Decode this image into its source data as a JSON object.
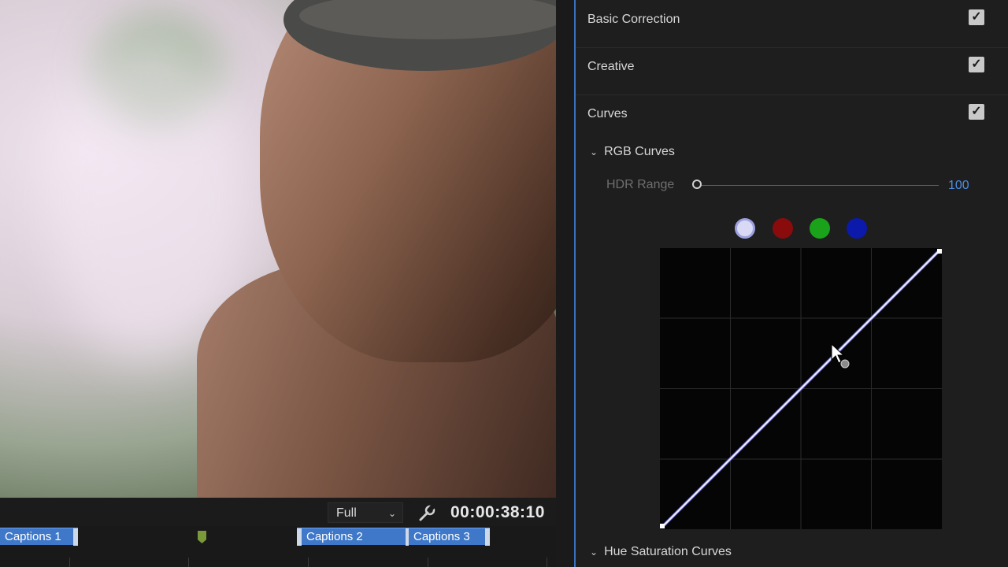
{
  "preview": {
    "resolution": "Full",
    "timecode": "00:00:38:10"
  },
  "timeline": {
    "clips": [
      {
        "label": "Captions 1"
      },
      {
        "label": "Captions 2"
      },
      {
        "label": "Captions 3"
      }
    ]
  },
  "panel": {
    "sections": [
      {
        "label": "Basic Correction",
        "checked": true
      },
      {
        "label": "Creative",
        "checked": true
      },
      {
        "label": "Curves",
        "checked": true
      }
    ],
    "rgb_curves": {
      "label": "RGB Curves",
      "hdr_label": "HDR Range",
      "hdr_value": "100",
      "channels": [
        {
          "name": "white",
          "color": "#d9d9f6",
          "active": true
        },
        {
          "name": "red",
          "color": "#8a0b0b"
        },
        {
          "name": "green",
          "color": "#1aa31a"
        },
        {
          "name": "blue",
          "color": "#0b1aaa"
        }
      ]
    },
    "hue_label": "Hue Saturation Curves"
  },
  "colors": {
    "accent": "#3a72c0",
    "value_blue": "#4b8ee6",
    "caption_clip": "#3f78c8"
  }
}
